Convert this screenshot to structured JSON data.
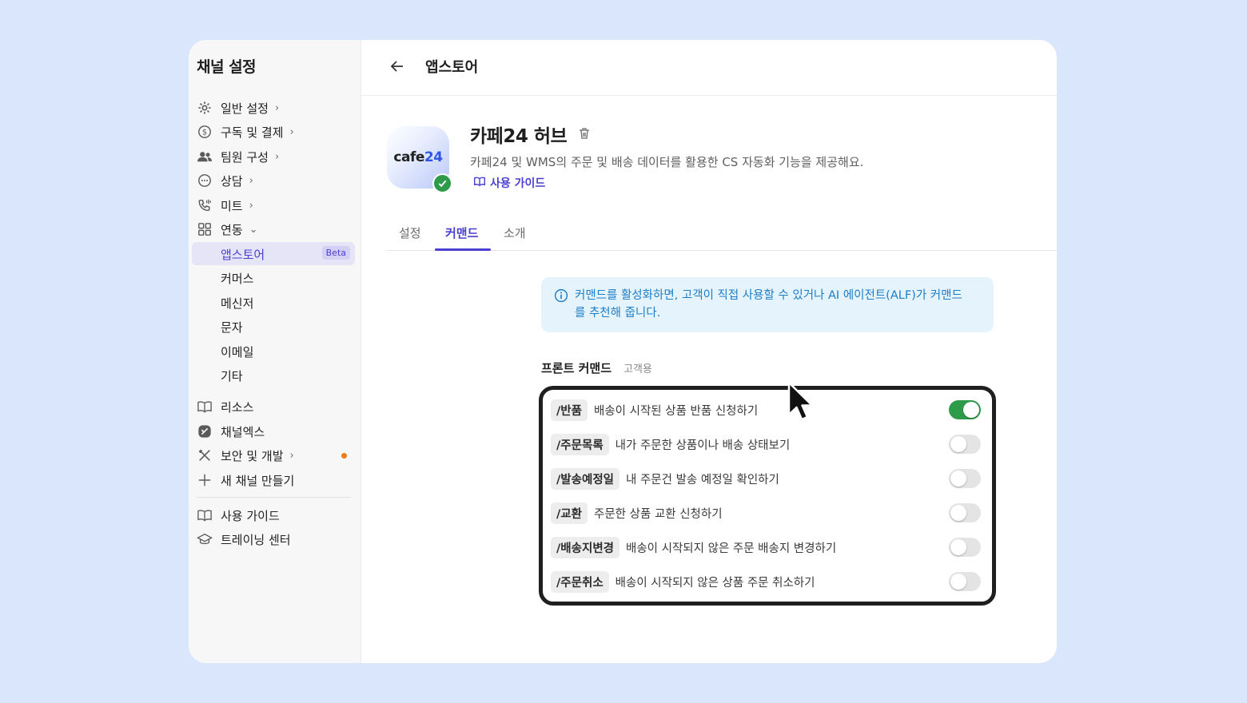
{
  "sidebar": {
    "title": "채널 설정",
    "items": [
      {
        "label": "일반 설정",
        "icon": "gear-icon",
        "chevron": "›"
      },
      {
        "label": "구독 및 결제",
        "icon": "dollar-circle-icon",
        "chevron": "›"
      },
      {
        "label": "팀원 구성",
        "icon": "people-icon",
        "chevron": "›"
      },
      {
        "label": "상담",
        "icon": "chat-bubble-icon",
        "chevron": "›"
      },
      {
        "label": "미트",
        "icon": "phone-icon",
        "chevron": "›"
      },
      {
        "label": "연동",
        "icon": "grid-icon",
        "chevron": "⌄"
      }
    ],
    "sub_items": [
      "앱스토어",
      "커머스",
      "메신저",
      "문자",
      "이메일",
      "기타"
    ],
    "active_sub": "앱스토어",
    "beta_badge": "Beta",
    "items2": [
      {
        "label": "리소스",
        "icon": "book-icon"
      },
      {
        "label": "채널엑스",
        "icon": "channelx-icon"
      },
      {
        "label": "보안 및 개발",
        "icon": "tools-icon",
        "chevron": "›"
      },
      {
        "label": "새 채널 만들기",
        "icon": "plus-icon"
      }
    ],
    "items3": [
      {
        "label": "사용 가이드",
        "icon": "book-icon"
      },
      {
        "label": "트레이닝 센터",
        "icon": "graduation-cap-icon"
      }
    ]
  },
  "header": {
    "title": "앱스토어"
  },
  "app": {
    "name": "카페24 허브",
    "logo_text": "cafe",
    "logo_num": "24",
    "description": "카페24 및 WMS의 주문 및 배송 데이터를 활용한 CS 자동화 기능을 제공해요.",
    "guide_link": "사용 가이드"
  },
  "tabs": [
    {
      "label": "설정",
      "active": false
    },
    {
      "label": "커맨드",
      "active": true
    },
    {
      "label": "소개",
      "active": false
    }
  ],
  "info": {
    "line1": "커맨드를 활성화하면, 고객이 직접 사용할 수 있거나 AI 에이전트(ALF)가 커맨드",
    "line2": "를 추천해 줍니다."
  },
  "section": {
    "title": "프론트 커맨드",
    "subtitle": "고객용"
  },
  "commands": [
    {
      "cmd": "/반품",
      "desc": "배송이 시작된 상품 반품 신청하기",
      "enabled": true
    },
    {
      "cmd": "/주문목록",
      "desc": "내가 주문한 상품이나 배송 상태보기",
      "enabled": false
    },
    {
      "cmd": "/발송예정일",
      "desc": "내 주문건 발송 예정일 확인하기",
      "enabled": false
    },
    {
      "cmd": "/교환",
      "desc": "주문한 상품 교환 신청하기",
      "enabled": false
    },
    {
      "cmd": "/배송지변경",
      "desc": "배송이 시작되지 않은 주문 배송지 변경하기",
      "enabled": false
    },
    {
      "cmd": "/주문취소",
      "desc": "배송이 시작되지 않은 상품 주문 취소하기",
      "enabled": false
    }
  ],
  "colors": {
    "accent": "#4a3fd0",
    "toggle_on": "#2d9b4a",
    "info_text": "#1b7ec9",
    "info_bg": "#e5f3fc",
    "notify_dot": "#ef7a16"
  }
}
